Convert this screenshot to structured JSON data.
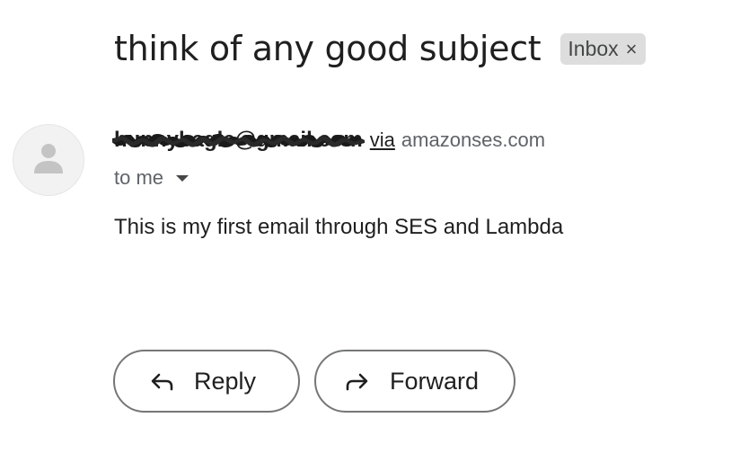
{
  "subject": "think of any good subject",
  "label": {
    "text": "Inbox",
    "close_glyph": "×"
  },
  "sender": {
    "email": "hunnybagle@gmail.com",
    "via_text": "via",
    "via_domain": "amazonses.com",
    "avatar_icon": "person-icon"
  },
  "recipient": {
    "text": "to me"
  },
  "body": {
    "text": "This is my first email through SES and Lambda"
  },
  "actions": {
    "reply_label": "Reply",
    "reply_icon": "reply-arrow-icon",
    "forward_label": "Forward",
    "forward_icon": "forward-arrow-icon"
  },
  "colors": {
    "text_primary": "#1f1f1f",
    "text_secondary": "#5f6368",
    "chip_bg": "#dddddd",
    "button_border": "#747775"
  }
}
